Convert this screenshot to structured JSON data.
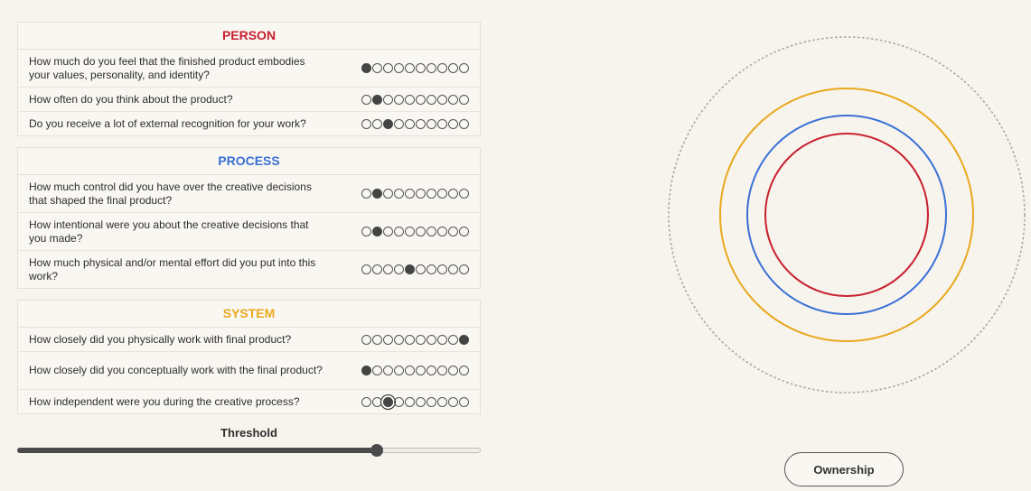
{
  "colors": {
    "person": "#c8202f",
    "process": "#3a70d4",
    "system": "#e9a91e",
    "outer_ring": "#a9a7a3"
  },
  "scale_points": 10,
  "sections": [
    {
      "key": "person",
      "title": "PERSON",
      "questions": [
        {
          "text": "How much do you feel that the finished product embodies your values, personality, and identity?",
          "value": 1,
          "lines": 2
        },
        {
          "text": "How often do you think about the product?",
          "value": 2,
          "lines": 1
        },
        {
          "text": "Do you receive a lot of external recognition for your work?",
          "value": 3,
          "lines": 1
        }
      ]
    },
    {
      "key": "process",
      "title": "PROCESS",
      "questions": [
        {
          "text": "How much control did you have over the creative decisions that shaped the final product?",
          "value": 2,
          "lines": 2
        },
        {
          "text": "How intentional were you about the creative decisions that you made?",
          "value": 2,
          "lines": 2
        },
        {
          "text": "How much physical and/or mental effort did you put into this work?",
          "value": 5,
          "lines": 2
        }
      ]
    },
    {
      "key": "system",
      "title": "SYSTEM",
      "questions": [
        {
          "text": "How closely did you physically work with final product?",
          "value": 10,
          "lines": 1
        },
        {
          "text": "How closely did you conceptually work with the final product?",
          "value": 1,
          "lines": 2
        },
        {
          "text": "How independent were you during the creative process?",
          "value": 3,
          "lines": 1,
          "focused": true
        }
      ]
    }
  ],
  "threshold": {
    "label": "Threshold",
    "value_fraction": 0.775
  },
  "visualization": {
    "rings": [
      "system",
      "process",
      "person"
    ]
  },
  "ownership_button": {
    "label": "Ownership"
  }
}
